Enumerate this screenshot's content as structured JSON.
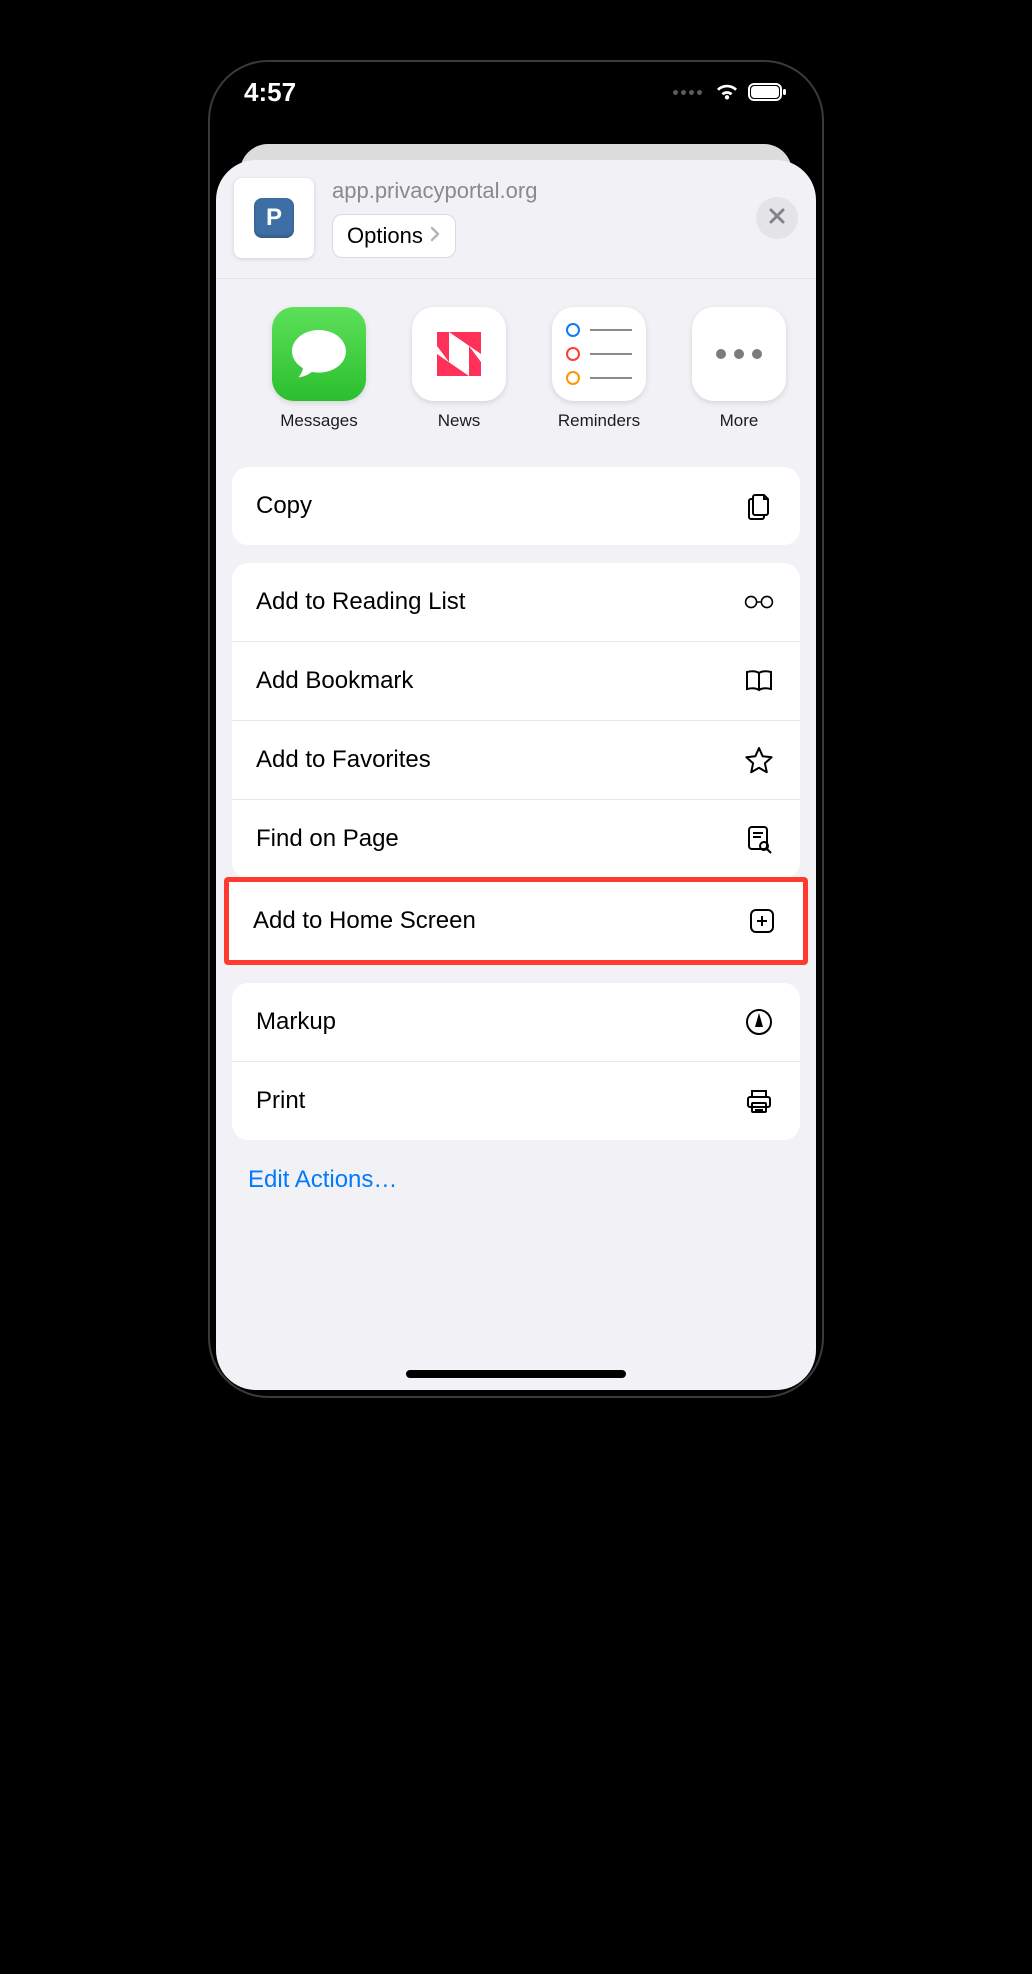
{
  "status": {
    "time": "4:57"
  },
  "header": {
    "url": "app.privacyportal.org",
    "options_label": "Options",
    "site_letter": "P"
  },
  "apps": [
    {
      "label": "Messages",
      "icon": "messages-icon"
    },
    {
      "label": "News",
      "icon": "news-icon"
    },
    {
      "label": "Reminders",
      "icon": "reminders-icon"
    },
    {
      "label": "More",
      "icon": "more-icon"
    }
  ],
  "groups": [
    {
      "items": [
        {
          "label": "Copy",
          "icon": "copy-icon"
        }
      ]
    },
    {
      "items": [
        {
          "label": "Add to Reading List",
          "icon": "glasses-icon"
        },
        {
          "label": "Add Bookmark",
          "icon": "book-icon"
        },
        {
          "label": "Add to Favorites",
          "icon": "star-icon"
        },
        {
          "label": "Find on Page",
          "icon": "find-icon"
        },
        {
          "label": "Add to Home Screen",
          "icon": "add-home-icon",
          "highlighted": true
        }
      ]
    },
    {
      "items": [
        {
          "label": "Markup",
          "icon": "markup-icon"
        },
        {
          "label": "Print",
          "icon": "print-icon"
        }
      ]
    }
  ],
  "edit_actions_label": "Edit Actions…"
}
